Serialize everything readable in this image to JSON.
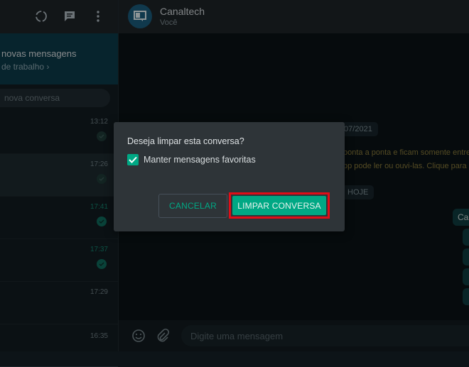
{
  "sidebar": {
    "banner": {
      "title": "novas mensagens",
      "link": "de trabalho ›"
    },
    "search": {
      "placeholder": "nova conversa"
    },
    "chats": [
      {
        "time": "13:12",
        "time_status": "muted"
      },
      {
        "time": "17:26",
        "time_status": "muted"
      },
      {
        "time": "17:41",
        "time_status": "green"
      },
      {
        "time": "17:37",
        "time_status": "green"
      },
      {
        "time": "17:29",
        "time_status": "muted"
      },
      {
        "time": "16:35",
        "time_status": "muted"
      }
    ]
  },
  "chat": {
    "contact_name": "Canaltech",
    "contact_sub": "Você",
    "date_pill": "/07/2021",
    "encryption_line1": "ponta a ponta e ficam somente entre v",
    "encryption_line2": "pp pode ler ou ouvi-las. Clique para sab",
    "today_pill": "HOJE",
    "bubble_text": "Ca",
    "composer_placeholder": "Digite uma mensagem"
  },
  "dialog": {
    "title": "Deseja limpar esta conversa?",
    "checkbox_label": "Manter mensagens favoritas",
    "checkbox_checked": true,
    "cancel_label": "CANCELAR",
    "confirm_label": "LIMPAR CONVERSA"
  },
  "colors": {
    "accent": "#00a884",
    "highlight_border": "#e00e18",
    "dialog_bg": "#2e3438"
  }
}
